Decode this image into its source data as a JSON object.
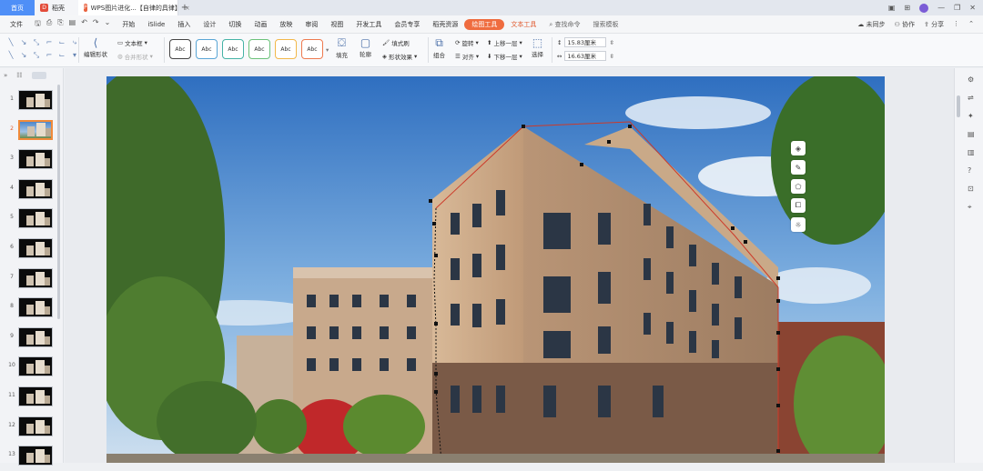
{
  "titlebar": {
    "home_tab": "首页",
    "daoke_tab": "稻壳",
    "doc_tab": "WPS图片进化...【自律的具律】",
    "doc_close": "×",
    "new_tab": "+"
  },
  "menu": {
    "file": "文件",
    "items": [
      "开始",
      "iSlide",
      "插入",
      "设计",
      "切换",
      "动画",
      "放映",
      "审阅",
      "视图",
      "开发工具",
      "会员专享",
      "稻壳资源"
    ],
    "drawing_tools": "绘图工具",
    "text_tools": "文本工具",
    "search": "查找命令",
    "search_template": "搜索模板",
    "unsync": "未同步",
    "collab": "协作",
    "share": "分享"
  },
  "ribbon": {
    "edit_shape": "编辑形状",
    "textbox": "文本框",
    "merge_shape": "合并形状",
    "style_samples": [
      "Abc",
      "Abc",
      "Abc",
      "Abc",
      "Abc",
      "Abc"
    ],
    "fill": "填充",
    "outline": "轮廓",
    "fill_format": "填式刷",
    "shape_effects": "形状效果",
    "group": "组合",
    "rotate": "旋转",
    "align": "对齐",
    "bring_forward": "上移一层",
    "send_backward": "下移一层",
    "select": "选择",
    "height": "15.83厘米",
    "width": "16.63厘米"
  },
  "slides": {
    "numbers": [
      "1",
      "2",
      "3",
      "4",
      "5",
      "6",
      "7",
      "8",
      "9",
      "10",
      "11",
      "12",
      "13"
    ],
    "active_index": 2
  },
  "colors": {
    "accent_orange": "#ef6c3f",
    "tab_blue": "#4f8ff7",
    "selection_border": "#f08a3a"
  }
}
